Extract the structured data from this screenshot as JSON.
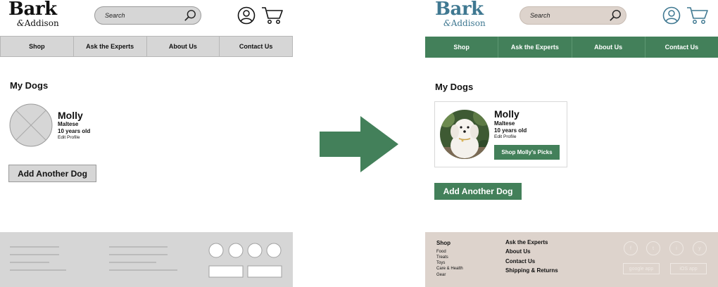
{
  "logo": {
    "main": "Bark",
    "amp": "&",
    "sub": "Addison"
  },
  "search": {
    "placeholder": "Search"
  },
  "nav": [
    "Shop",
    "Ask the Experts",
    "About Us",
    "Contact Us"
  ],
  "my_dogs": {
    "title": "My Dogs",
    "dog": {
      "name": "Molly",
      "breed": "Maltese",
      "age": "10 years old",
      "edit": "Edit Profile",
      "shop_button": "Shop Molly's Picks"
    },
    "add_button": "Add Another Dog"
  },
  "footer": {
    "shop_heading": "Shop",
    "shop_links": [
      "Food",
      "Treats",
      "Toys",
      "Care & Health",
      "Gear"
    ],
    "links": [
      "Ask the Experts",
      "About Us",
      "Contact Us",
      "Shipping & Returns"
    ],
    "social": [
      "f",
      "t",
      "i",
      "y"
    ],
    "apps": [
      "google app",
      "iOS app"
    ]
  },
  "colors": {
    "brand_green": "#43805a",
    "logo_blue": "#3f7891",
    "footer_beige": "#ddd3cc",
    "search_beige": "#ddd3cc",
    "wire_gray": "#d6d6d6"
  },
  "icons": {
    "search": "search-icon",
    "account": "account-icon",
    "cart": "cart-icon",
    "arrow": "right-arrow-icon"
  }
}
